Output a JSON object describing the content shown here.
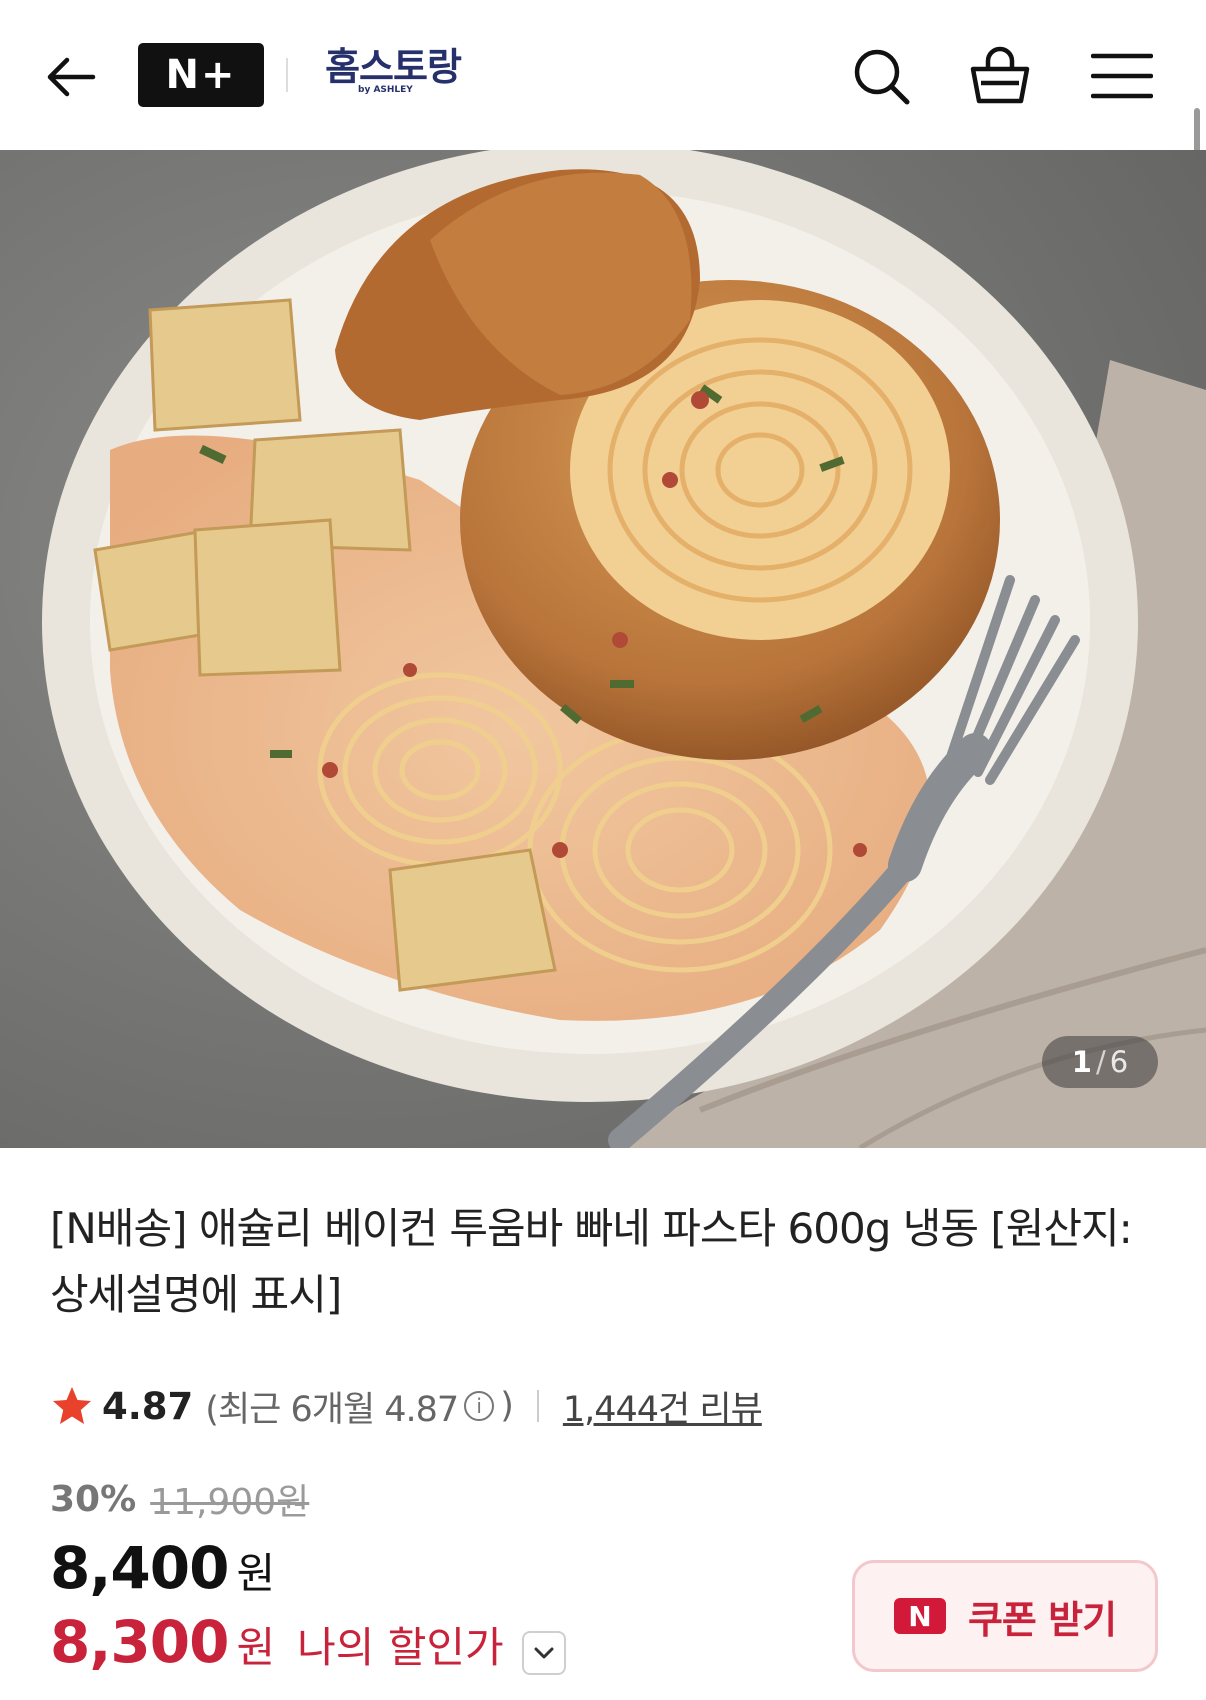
{
  "header": {
    "logo_text": "N+",
    "brand_name": "홈스토랑",
    "brand_sub": "by ASHLEY"
  },
  "gallery": {
    "current": "1",
    "separator": "/",
    "total": "6"
  },
  "product": {
    "title": "[N배송] 애슐리 베이컨 투움바 빠네 파스타 600g 냉동 [원산지:상세설명에 표시]",
    "rating": "4.87",
    "recent_rating_prefix": "(최근 6개월 4.87",
    "recent_rating_suffix": ")",
    "info_icon": "i",
    "review_count": "1,444건 리뷰",
    "discount_percent": "30%",
    "original_price": "11,900원",
    "price": "8,400",
    "price_unit": "원",
    "my_price": "8,300",
    "my_price_unit": "원",
    "my_price_label": "나의 할인가"
  },
  "coupon": {
    "badge": "N",
    "label": "쿠폰 받기"
  },
  "colors": {
    "accent_red": "#c8233a",
    "star": "#e8412c",
    "brand_navy": "#26306b"
  },
  "icons": [
    "back-arrow-icon",
    "search-icon",
    "shopping-bag-icon",
    "hamburger-menu-icon",
    "star-icon",
    "info-icon",
    "chevron-down-icon"
  ]
}
